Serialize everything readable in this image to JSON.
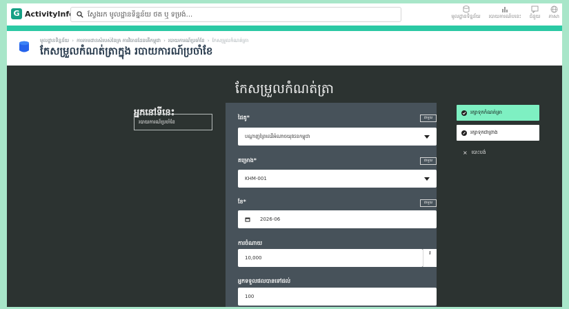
{
  "app": {
    "name": "ActivityInfo",
    "logo_letter": "G"
  },
  "search": {
    "placeholder": "ស្វែងរក មូលដ្ឋានទិន្នន័យ ថត ឬ ទម្រង់..."
  },
  "topnav": [
    {
      "label": "មូលដ្ឋានទិន្នន័យ",
      "icon": "database-icon"
    },
    {
      "label": "របាយការណ៍បនេះ",
      "icon": "chart-icon"
    },
    {
      "label": "ជំនួយ",
      "icon": "chat-icon"
    },
    {
      "label": "ភាសា",
      "icon": "globe-icon"
    }
  ],
  "breadcrumb": {
    "items": [
      "មូលដ្ឋានទិន្នន័យ",
      "ការតាមដានសំរបស់នៃគ្រ ការវិធានដែនគើកម្ពុជា",
      "របាយការណ៍ប្រចាំខែ",
      "កែសម្រួលកំណត់ត្រា"
    ]
  },
  "page_title": "កែសម្រួលកំណត់ត្រាក្នុង របាយការណ៍ប្រចាំខែ",
  "form": {
    "title": "កែសម្រួលកំណត់ត្រា",
    "left_heading": "អ្នកនៅទីនេះ",
    "left_box": "របាយការណ៍ប្រចាំខែ",
    "fields": [
      {
        "label": "ដៃគូ*",
        "button": "ជាមួយ",
        "value": "បណ្តាញព្រៃឈើអំណាចយុវជនកម្ពុជា"
      },
      {
        "label": "គម្រោង*",
        "button": "ជាមួយ",
        "value": "KHM-001"
      },
      {
        "label": "ខែ*",
        "button": "ជាមួយ",
        "value": "2026-06"
      },
      {
        "label": "ការចំណាយ",
        "value": "10,000",
        "addon": "៛"
      },
      {
        "label": "អ្នកទទួលផលបានទៅដល់",
        "value": "100"
      }
    ]
  },
  "actions": {
    "save": "រក្សាទុកកំណត់ត្រា",
    "save_draft": "រក្សាទុកជាព្រាង",
    "cancel": "បោះបង់"
  },
  "colors": {
    "accent": "#2bc9a4",
    "primary_button": "#7ef0c2",
    "panel": "#47525a",
    "background": "#2c3331",
    "outer": "#a8e6c9"
  }
}
